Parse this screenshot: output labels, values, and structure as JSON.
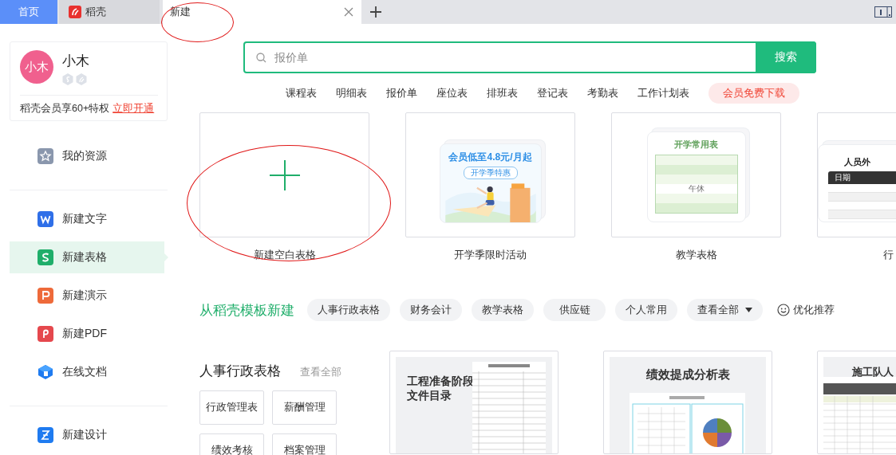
{
  "tabs": [
    {
      "kind": "home",
      "label": "首页",
      "selected": false
    },
    {
      "kind": "docer",
      "label": "稻壳",
      "selected": false
    },
    {
      "kind": "doc",
      "label": "新建",
      "selected": true
    }
  ],
  "user": {
    "avatar": "小木",
    "name": "小木",
    "promo": "稻壳会员享60+特权",
    "promo_link": "立即开通"
  },
  "sidebar": {
    "groups": [
      [
        {
          "label": "我的资源",
          "selected": false
        }
      ],
      [
        {
          "label": "新建文字",
          "selected": false
        },
        {
          "label": "新建表格",
          "selected": true
        },
        {
          "label": "新建演示",
          "selected": false
        },
        {
          "label": "新建PDF",
          "selected": false
        },
        {
          "label": "在线文档",
          "selected": false
        }
      ],
      [
        {
          "label": "新建设计",
          "selected": false
        }
      ]
    ]
  },
  "search": {
    "placeholder": "报价单",
    "button": "搜索"
  },
  "hot_words": [
    "课程表",
    "明细表",
    "报价单",
    "座位表",
    "排班表",
    "登记表",
    "考勤表",
    "工作计划表"
  ],
  "vip_download": "会员免费下载",
  "new_cards": [
    {
      "kind": "blank",
      "label": "新建空白表格"
    },
    {
      "kind": "promo",
      "label": "开学季限时活动",
      "title": "会员低至4.8元/月起",
      "tag": "开学季特惠"
    },
    {
      "kind": "table",
      "label": "教学表格",
      "title": "开学常用表",
      "note": "午休"
    },
    {
      "kind": "dark-table",
      "label": "行",
      "title": "人员外",
      "header": "日期"
    }
  ],
  "template_bar": {
    "title": "从稻壳模板新建",
    "filters": [
      "人事行政表格",
      "财务会计",
      "教学表格",
      "供应链",
      "个人常用"
    ],
    "more": "查看全部",
    "recommend": "优化推荐"
  },
  "category": {
    "title": "人事行政表格",
    "more": "查看全部",
    "items": [
      "行政管理表",
      "薪酬管理",
      "绩效考核",
      "档案管理"
    ]
  },
  "templates": [
    {
      "kind": "list",
      "title": "工程准备阶段文件目录"
    },
    {
      "kind": "pie",
      "title": "绩效提成分析表"
    },
    {
      "kind": "roster",
      "title": "施工队人"
    }
  ],
  "markup": [
    {
      "kind": "ellipse"
    },
    {
      "kind": "ellipse"
    }
  ]
}
